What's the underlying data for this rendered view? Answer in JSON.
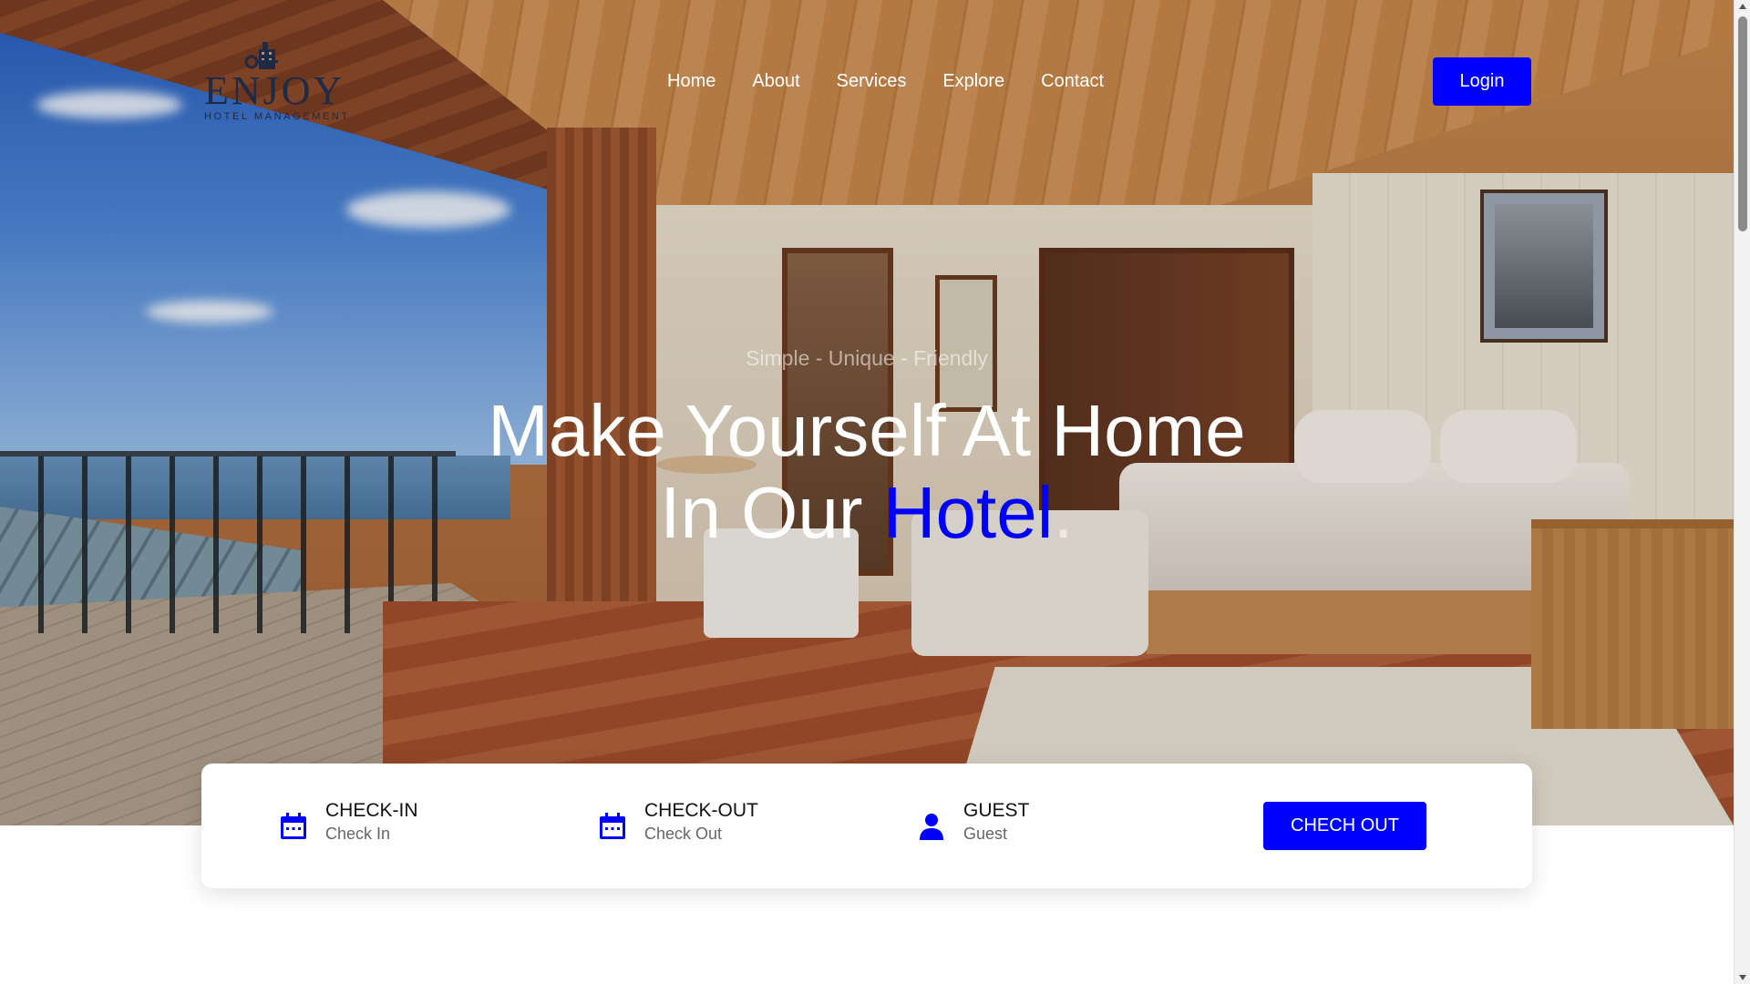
{
  "brand": {
    "name": "ENJOY",
    "subtitle": "HOTEL MANAGEMENT"
  },
  "nav": {
    "items": [
      {
        "label": "Home"
      },
      {
        "label": "About"
      },
      {
        "label": "Services"
      },
      {
        "label": "Explore"
      },
      {
        "label": "Contact"
      }
    ],
    "login_label": "Login"
  },
  "hero": {
    "tagline": "Simple - Unique - Friendly",
    "headline_line1": "Make Yourself At Home",
    "headline_line2_prefix": "In Our ",
    "headline_accent": "Hotel",
    "headline_suffix": "."
  },
  "booking": {
    "fields": [
      {
        "label": "CHECK-IN",
        "value": "Check In",
        "icon": "calendar-icon"
      },
      {
        "label": "CHECK-OUT",
        "value": "Check Out",
        "icon": "calendar-icon"
      },
      {
        "label": "GUEST",
        "value": "Guest",
        "icon": "user-icon"
      }
    ],
    "button_label": "CHECH OUT"
  },
  "colors": {
    "accent": "#0000ff",
    "text_dark": "#111111",
    "text_muted": "#666666",
    "logo": "#1f2a44"
  }
}
